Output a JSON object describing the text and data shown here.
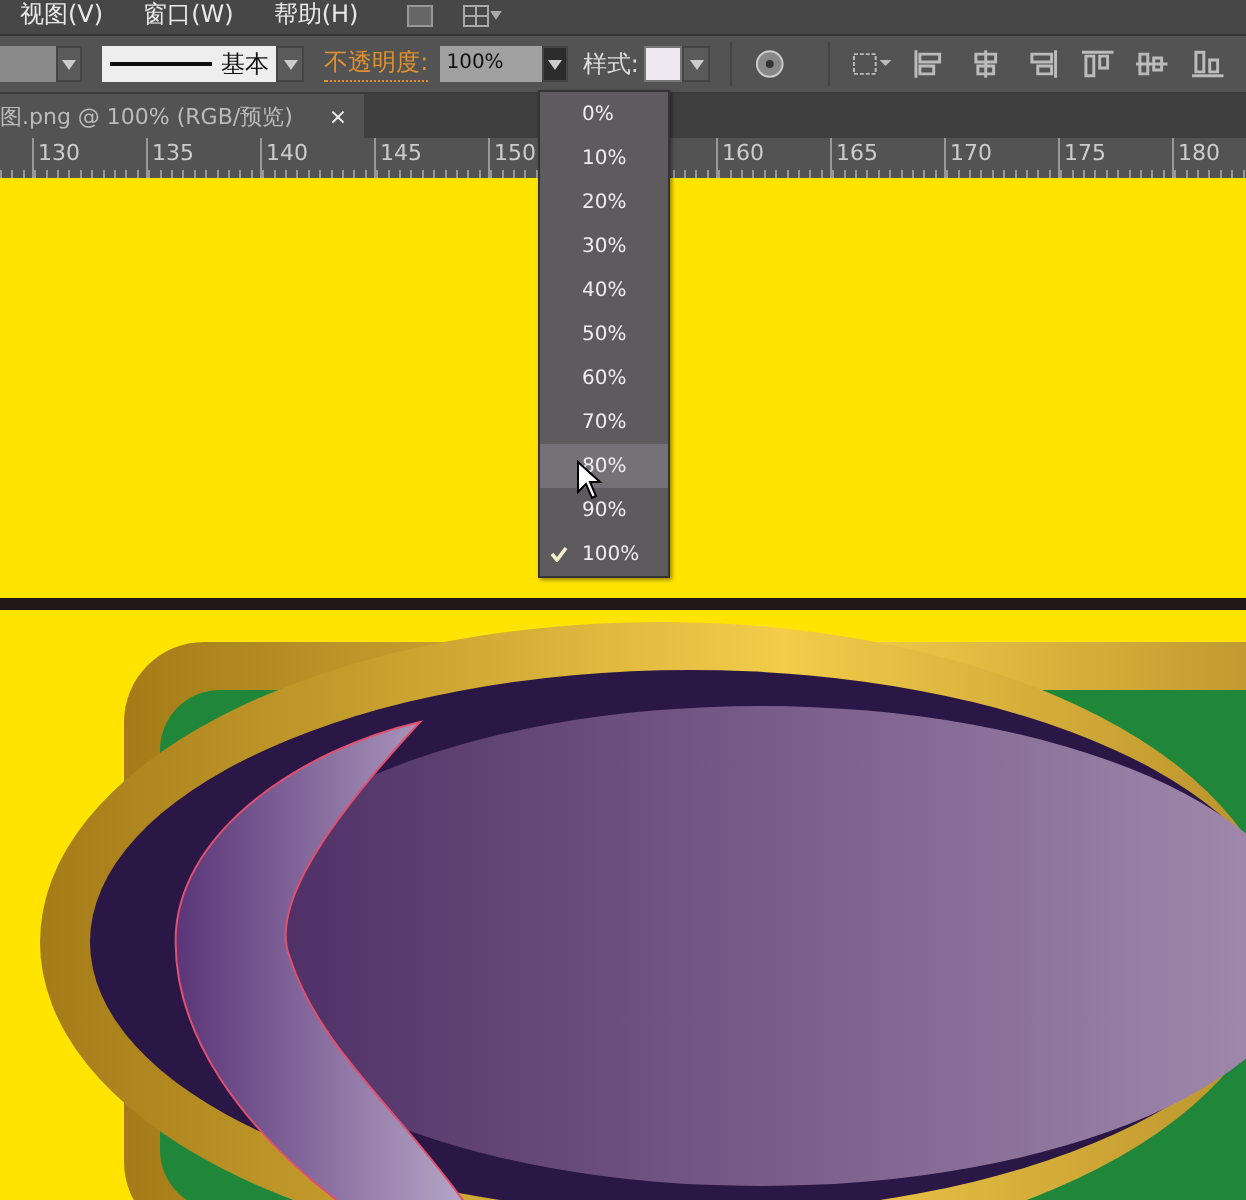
{
  "menu_bar": {
    "items": [
      "视图(V)",
      "窗口(W)",
      "帮助(H)"
    ]
  },
  "control_bar": {
    "stroke_style": {
      "value": "基本"
    },
    "opacity": {
      "label": "不透明度:",
      "value": "100%"
    },
    "style": {
      "label": "样式:"
    }
  },
  "document_tab": {
    "title": "图.png @ 100% (RGB/预览)",
    "close": "×"
  },
  "ruler": {
    "labels": [
      "130",
      "135",
      "140",
      "145",
      "150",
      "160",
      "165",
      "170",
      "175",
      "180"
    ]
  },
  "opacity_menu": {
    "items": [
      {
        "label": "0%",
        "checked": false,
        "highlighted": false
      },
      {
        "label": "10%",
        "checked": false,
        "highlighted": false
      },
      {
        "label": "20%",
        "checked": false,
        "highlighted": false
      },
      {
        "label": "30%",
        "checked": false,
        "highlighted": false
      },
      {
        "label": "40%",
        "checked": false,
        "highlighted": false
      },
      {
        "label": "50%",
        "checked": false,
        "highlighted": false
      },
      {
        "label": "60%",
        "checked": false,
        "highlighted": false
      },
      {
        "label": "70%",
        "checked": false,
        "highlighted": false
      },
      {
        "label": "80%",
        "checked": false,
        "highlighted": true
      },
      {
        "label": "90%",
        "checked": false,
        "highlighted": false
      },
      {
        "label": "100%",
        "checked": true,
        "highlighted": false
      }
    ]
  }
}
